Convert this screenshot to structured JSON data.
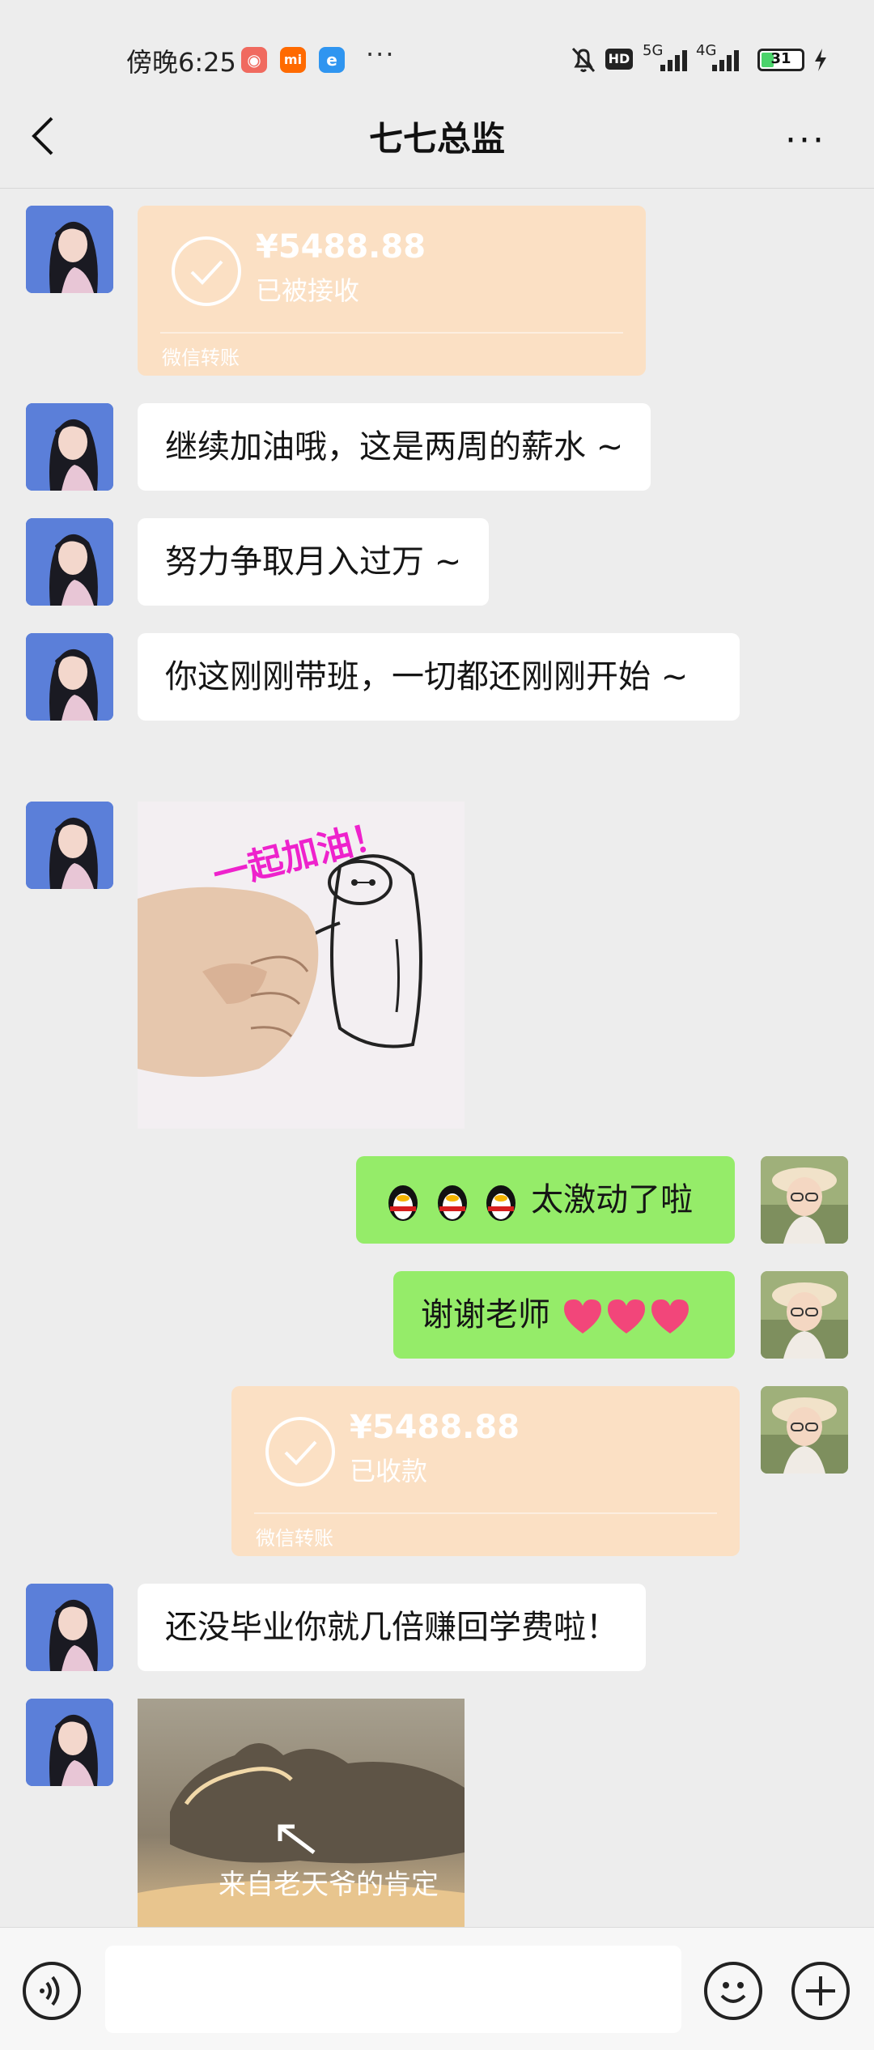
{
  "status_bar": {
    "time": "傍晚6:25",
    "dots": "···",
    "hd": "HD",
    "net5g": "5G",
    "net4g": "4G",
    "battery": "31",
    "battery_level": 0.31
  },
  "header": {
    "title": "七七总监"
  },
  "messages": {
    "transfer1": {
      "amount": "¥5488.88",
      "status": "已被接收",
      "label": "微信转账"
    },
    "text1": "继续加油哦，这是两周的薪水 ~",
    "text2": "努力争取月入过万 ~",
    "text3": "你这刚刚带班，一切都还刚刚开始 ~",
    "sticker1": {
      "caption": "一起加油！"
    },
    "reply1": "太激动了啦",
    "reply2": "谢谢老师",
    "transfer2": {
      "amount": "¥5488.88",
      "status": "已收款",
      "label": "微信转账"
    },
    "text4": "还没毕业你就几倍赚回学费啦！",
    "sticker2": {
      "caption": "来自老天爷的肯定"
    }
  },
  "colors": {
    "bubble_right": "#95ec69",
    "bubble_left": "#ffffff",
    "transfer": "#fbe0c4",
    "background": "#ededed"
  }
}
